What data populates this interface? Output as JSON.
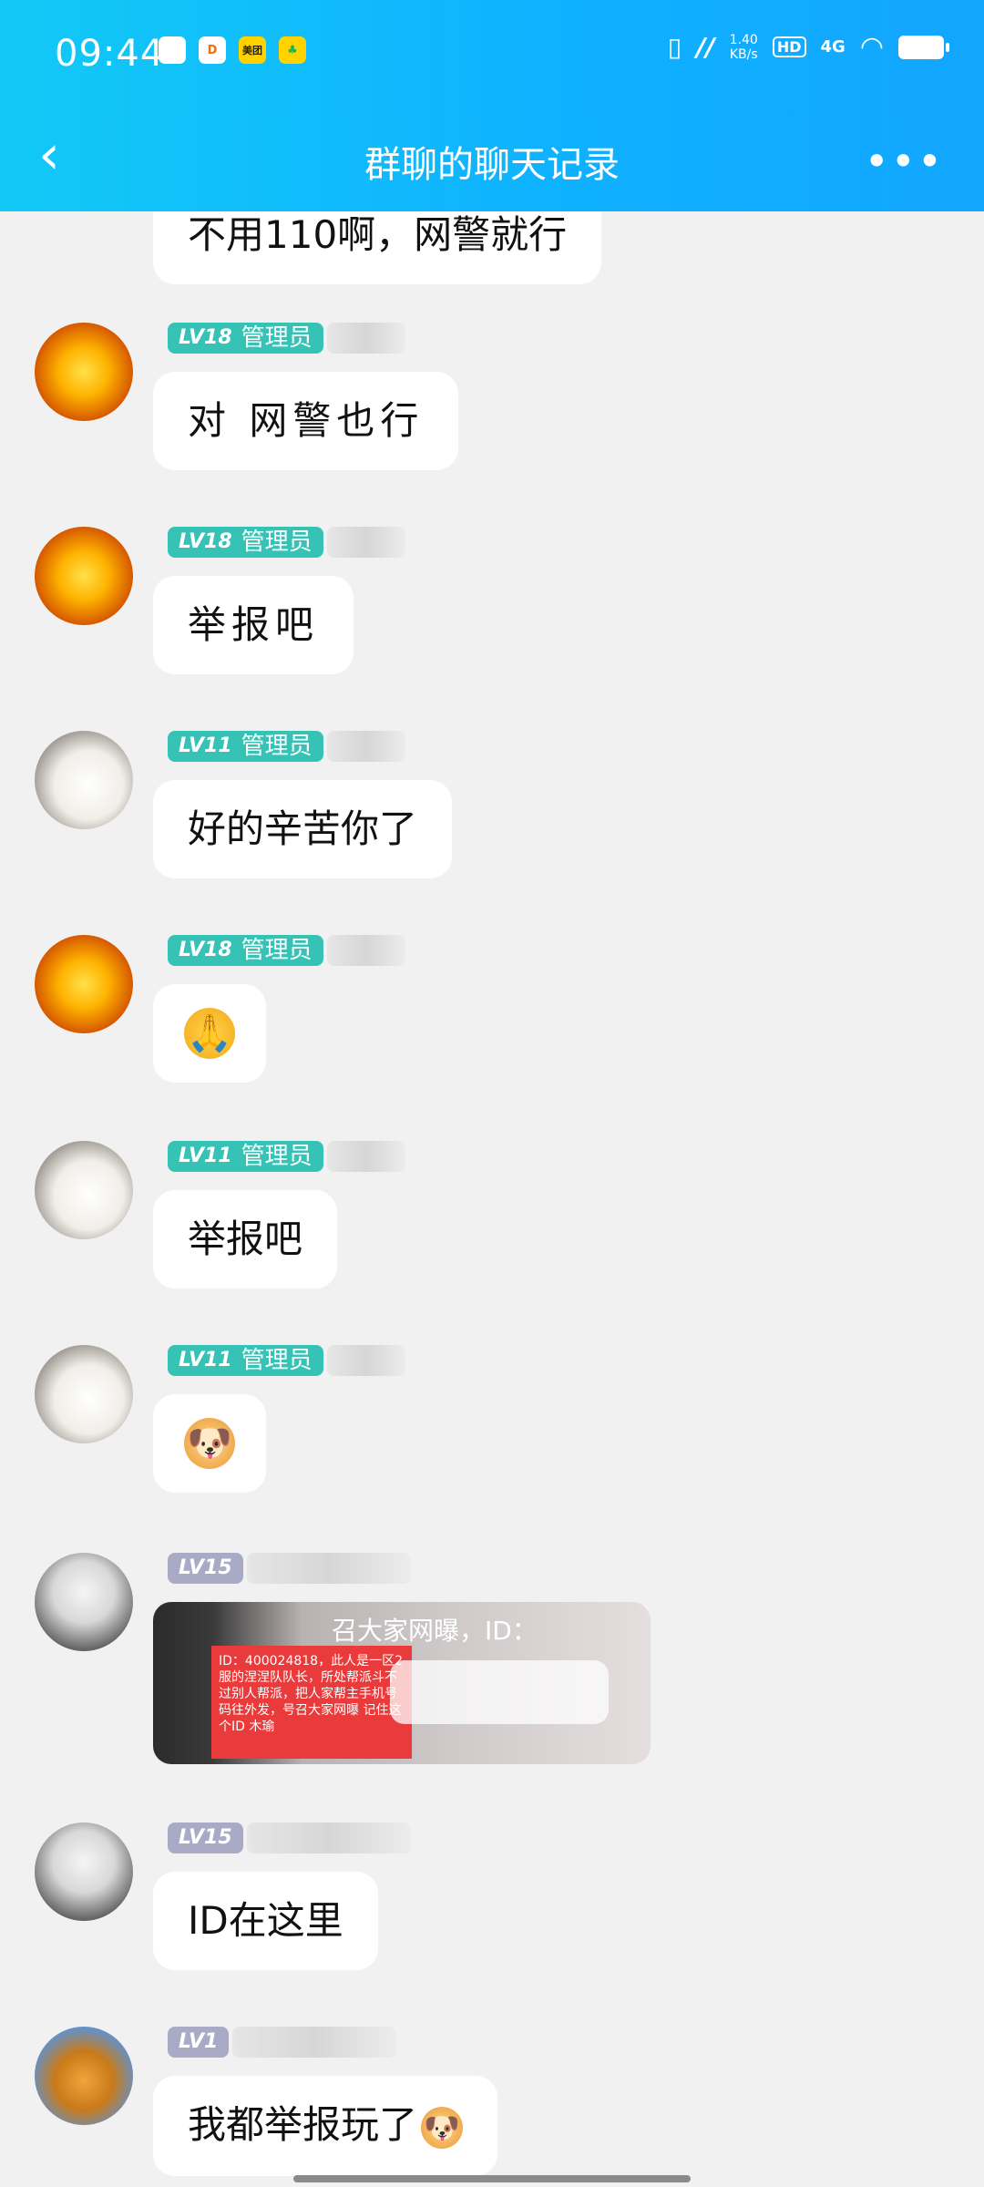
{
  "status_bar": {
    "time": "09:44",
    "apps": [
      "微",
      "D",
      "美团",
      "♣"
    ],
    "speed_top": "1.40",
    "speed_unit": "KB/s",
    "hd": "HD",
    "network": "4G"
  },
  "header": {
    "title": "群聊的聊天记录",
    "back_icon": "‹",
    "more_icon": "•••"
  },
  "messages": [
    {
      "text": "不用110啊，网警就行"
    },
    {
      "level": "LV18",
      "role": "管理员",
      "text": "对 网警也行"
    },
    {
      "level": "LV18",
      "role": "管理员",
      "text": "举报吧"
    },
    {
      "level": "LV11",
      "role": "管理员",
      "text": "好的辛苦你了"
    },
    {
      "level": "LV18",
      "role": "管理员",
      "emoji": "🙏"
    },
    {
      "level": "LV11",
      "role": "管理员",
      "text": "举报吧"
    },
    {
      "level": "LV11",
      "role": "管理员",
      "emoji": "🐶"
    },
    {
      "level": "LV15",
      "image": {
        "caption": "召大家网曝，ID：",
        "text": "ID：400024818，此人是一区2服的涅涅队队长，所处帮派斗不过别人帮派，把人家帮主手机号码往外发，号召大家网曝 记住这个ID 木瑜"
      }
    },
    {
      "level": "LV15",
      "text": "ID在这里"
    },
    {
      "level": "LV1",
      "text": "我都举报玩了",
      "emoji": "🐶"
    }
  ]
}
